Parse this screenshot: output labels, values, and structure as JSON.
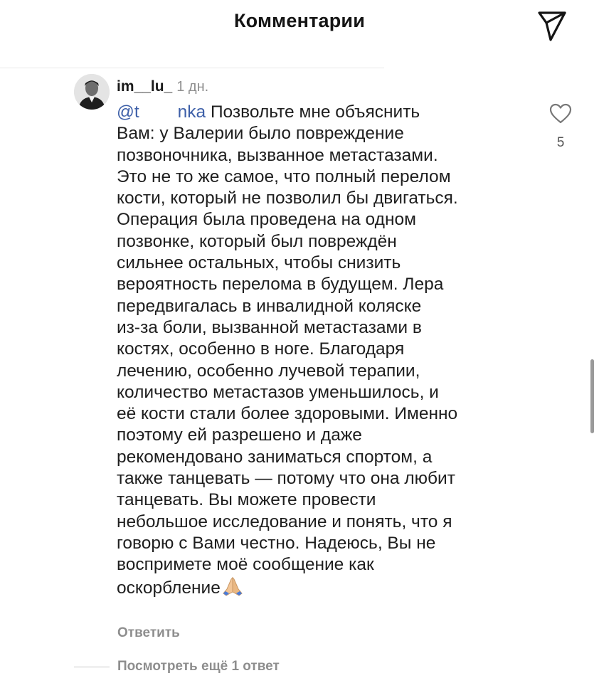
{
  "header": {
    "title": "Комментарии",
    "share_icon": "send-icon"
  },
  "comment": {
    "username": "im__lu_",
    "time": "1 дн.",
    "mention": "@t           nka",
    "text": " Позвольте мне объяснить\nВам: у Валерии было повреждение\nпозвоночника, вызванное метастазами.\nЭто не то же самое, что полный перелом\nкости, который не позволил бы двигаться.\nОперация была проведена на одном\nпозвонке, который был повреждён\nсильнее остальных, чтобы снизить\nвероятность перелома в будущем. Лера\nпередвигалась в инвалидной коляске\nиз-за боли, вызванной метастазами в\nкостях, особенно в ноге. Благодаря\nлечению, особенно лучевой терапии,\nколичество метастазов уменьшилось, и\nеё кости стали более здоровыми. Именно\nпоэтому ей разрешено и даже\nрекомендовано заниматься спортом, а\nтакже танцевать — потому что она любит\nтанцевать. Вы можете провести\nнебольшое исследование и понять, что я\nговорю с Вами честно. Надеюсь, Вы не\nвоспримете моё сообщение как\nоскорбление",
    "emoji": "folded-hands-icon",
    "likes": "5",
    "reply_label": "Ответить",
    "view_replies_label": "Посмотреть ещё 1 ответ"
  },
  "colors": {
    "mention": "#3d5fa8",
    "muted": "#8e8e8e"
  }
}
